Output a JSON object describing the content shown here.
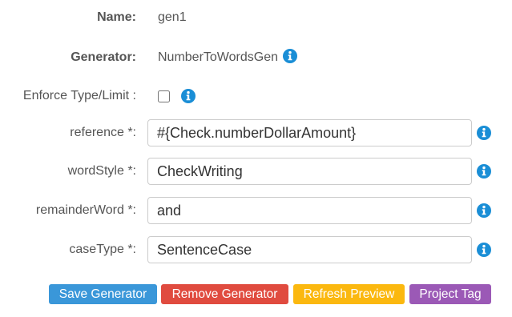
{
  "form": {
    "name": {
      "label": "Name:",
      "value": "gen1"
    },
    "generator": {
      "label": "Generator:",
      "value": "NumberToWordsGen"
    },
    "enforce": {
      "label": "Enforce Type/Limit :",
      "checked": false
    },
    "fields": [
      {
        "label": "reference *:",
        "value": "#{Check.numberDollarAmount}"
      },
      {
        "label": "wordStyle *:",
        "value": "CheckWriting"
      },
      {
        "label": "remainderWord *:",
        "value": "and"
      },
      {
        "label": "caseType *:",
        "value": "SentenceCase"
      }
    ]
  },
  "buttons": {
    "save": {
      "label": "Save Generator",
      "color": "#3a97d9"
    },
    "remove": {
      "label": "Remove Generator",
      "color": "#e04b3f"
    },
    "refresh": {
      "label": "Refresh Preview",
      "color": "#fbb80f"
    },
    "tag": {
      "label": "Project Tag",
      "color": "#9b59b6"
    }
  },
  "icons": {
    "info": "info-circle-icon",
    "info_color": "#1a8ed6"
  }
}
